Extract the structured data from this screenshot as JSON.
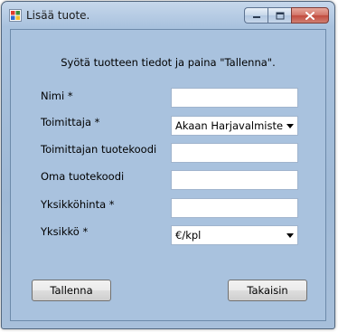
{
  "window": {
    "title": "Lisää tuote.",
    "icons": {
      "app": "app-icon",
      "minimize": "minimize-icon",
      "maximize": "maximize-icon",
      "close": "close-icon"
    }
  },
  "form": {
    "instruction": "Syötä tuotteen tiedot ja paina \"Tallenna\".",
    "fields": {
      "name": {
        "label": "Nimi *",
        "value": ""
      },
      "supplier": {
        "label": "Toimittaja *",
        "value": "Akaan Harjavalmiste"
      },
      "supplier_code": {
        "label": "Toimittajan tuotekoodi",
        "value": ""
      },
      "own_code": {
        "label": "Oma tuotekoodi",
        "value": ""
      },
      "unit_price": {
        "label": "Yksikköhinta *",
        "value": ""
      },
      "unit": {
        "label": "Yksikkö *",
        "value": "€/kpl"
      }
    },
    "buttons": {
      "save": "Tallenna",
      "back": "Takaisin"
    }
  },
  "colors": {
    "client_background": "#a9c2de",
    "close_button": "#c24b3e"
  }
}
